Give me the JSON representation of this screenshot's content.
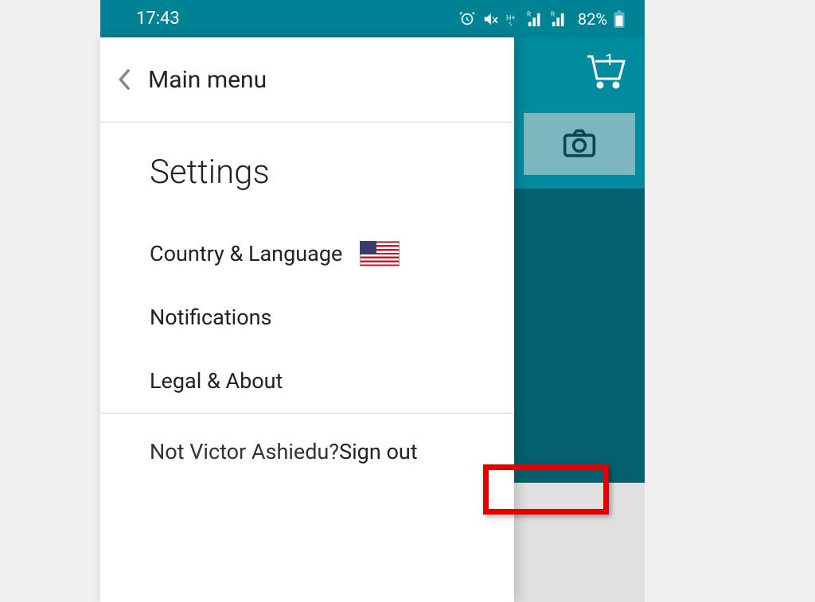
{
  "status": {
    "time": "17:43",
    "battery_percent": "82%",
    "cart_count": "1"
  },
  "drawer": {
    "title": "Main menu",
    "section": "Settings",
    "items": {
      "country": "Country & Language",
      "notifications": "Notifications",
      "legal": "Legal & About"
    },
    "signout_prefix": "Not Victor Ashiedu? ",
    "signout_link": "Sign out"
  }
}
